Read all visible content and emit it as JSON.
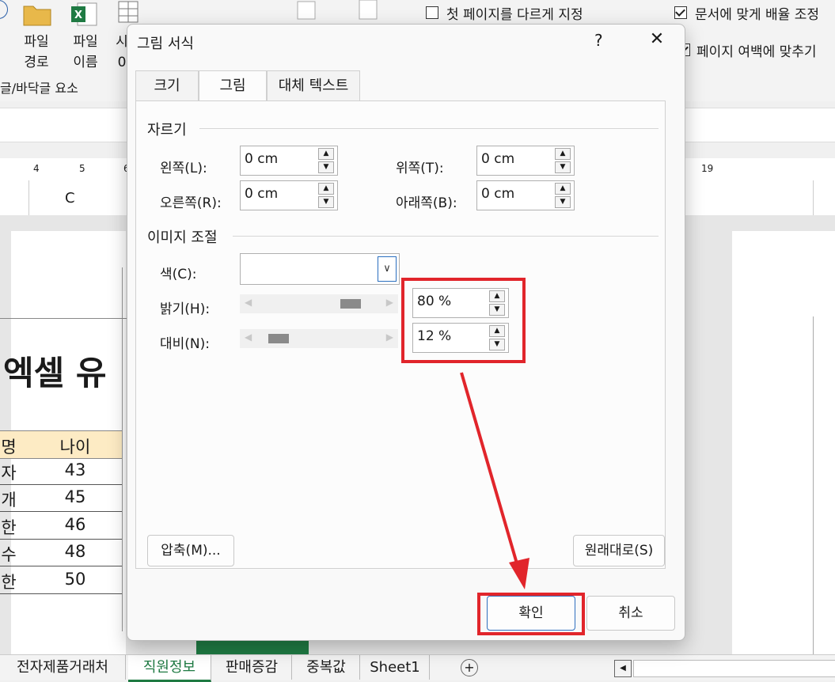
{
  "ribbon": {
    "btn_file_path": [
      "파일",
      "경로"
    ],
    "btn_file_name": [
      "파일",
      "이름"
    ],
    "btn_other_partial": [
      "시",
      "0"
    ],
    "group_label": "글/바닥글 요소",
    "opt_first_page": "첫 페이지를 다르게 지정",
    "opt_scale_doc": "문서에 맞게 배율 조정",
    "opt_align_margin": "페이지 여백에 맞추기",
    "opt_first_page_checked": false,
    "opt_scale_doc_checked": true,
    "opt_align_margin_checked": true
  },
  "ruler": {
    "ticks": [
      "4",
      "5",
      "6",
      "19"
    ]
  },
  "column_header": {
    "c": "C"
  },
  "sheet": {
    "title_partial": "엑셀 유",
    "header": [
      "명",
      "나이"
    ],
    "rows": [
      [
        "자",
        "43"
      ],
      [
        "개",
        "45"
      ],
      [
        "한",
        "46"
      ],
      [
        "수",
        "48"
      ],
      [
        "한",
        "50"
      ]
    ]
  },
  "sheet_tabs": [
    "전자제품거래처",
    "직원정보",
    "판매증감",
    "중복값",
    "Sheet1"
  ],
  "active_sheet_tab": "직원정보",
  "dialog": {
    "title": "그림 서식",
    "help": "?",
    "close": "✕",
    "tabs": [
      "크기",
      "그림",
      "대체 텍스트"
    ],
    "active_tab": "그림",
    "crop_section": "자르기",
    "crop": {
      "left_label": "왼쪽(L):",
      "left_value": "0 cm",
      "top_label": "위쪽(T):",
      "top_value": "0 cm",
      "right_label": "오른쪽(R):",
      "right_value": "0 cm",
      "bottom_label": "아래쪽(B):",
      "bottom_value": "0 cm"
    },
    "adjust_section": "이미지 조절",
    "color_label": "색(C):",
    "color_value": "",
    "brightness_label": "밝기(H):",
    "brightness_value": "80 %",
    "brightness_percent": 80,
    "contrast_label": "대비(N):",
    "contrast_value": "12 %",
    "contrast_percent": 12,
    "compress_button": "압축(M)...",
    "reset_button": "원래대로(S)",
    "ok_button": "확인",
    "cancel_button": "취소"
  },
  "colors": {
    "accent": "#2f6fbf",
    "annotation": "#e1252b",
    "excel_green": "#1f7a43"
  }
}
